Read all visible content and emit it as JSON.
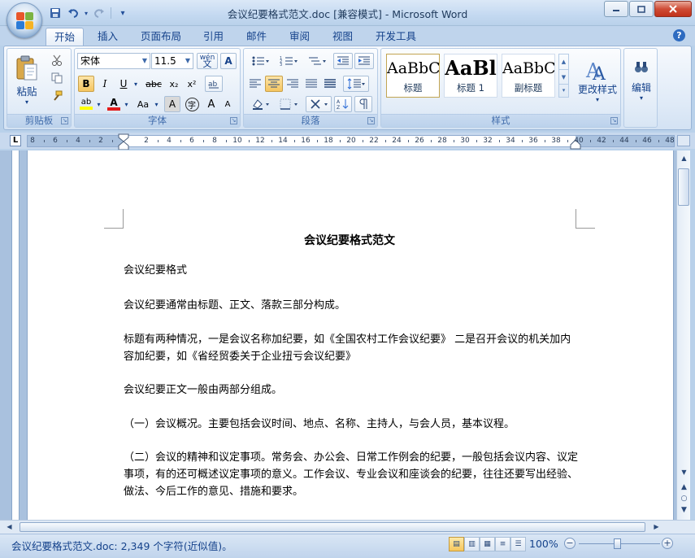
{
  "window": {
    "title": "会议纪要格式范文.doc [兼容模式] - Microsoft Word",
    "minimize": "—",
    "maximize": "□",
    "close": "✕"
  },
  "qat": {
    "save_icon": "save-icon",
    "undo_icon": "undo-icon",
    "redo_icon": "redo-icon",
    "customize": "▾"
  },
  "tabs": [
    {
      "label": "开始",
      "active": true
    },
    {
      "label": "插入"
    },
    {
      "label": "页面布局"
    },
    {
      "label": "引用"
    },
    {
      "label": "邮件"
    },
    {
      "label": "审阅"
    },
    {
      "label": "视图"
    },
    {
      "label": "开发工具"
    }
  ],
  "help": "?",
  "ribbon": {
    "clipboard": {
      "label": "剪贴板",
      "paste": "粘贴",
      "paste_arrow": "▾"
    },
    "font": {
      "label": "字体",
      "font_name": "宋体",
      "font_size": "11.5",
      "bold": "B",
      "italic": "I",
      "underline": "U",
      "strike": "abc",
      "subscript": "x₂",
      "superscript": "x²",
      "grow": "A",
      "shrink": "A",
      "change_case": "Aa",
      "char_border": "A",
      "enclose": "字",
      "wen": "wén",
      "clear": "A",
      "highlight": "ab",
      "fontcolor": "A"
    },
    "paragraph": {
      "label": "段落"
    },
    "styles": {
      "label": "样式",
      "items": [
        {
          "sample": "AaBbC",
          "name": "标题"
        },
        {
          "sample": "AaBl",
          "name": "标题 1"
        },
        {
          "sample": "AaBbC",
          "name": "副标题"
        }
      ],
      "change_styles": "更改样式"
    },
    "editing": {
      "label": "编辑"
    }
  },
  "ruler": {
    "corner": "L",
    "numbers": [
      "8",
      "6",
      "4",
      "2",
      "2",
      "4",
      "6",
      "8",
      "10",
      "12",
      "14",
      "16",
      "18",
      "20",
      "22",
      "24",
      "26",
      "28",
      "30",
      "32",
      "34",
      "36",
      "38",
      "40",
      "42",
      "44",
      "46",
      "48"
    ]
  },
  "document": {
    "title": "会议纪要格式范文",
    "paragraphs": [
      "会议纪要格式",
      "会议纪要通常由标题、正文、落款三部分构成。",
      "标题有两种情况，一是会议名称加纪要，如《全国农村工作会议纪要》 二是召开会议的机关加内容加纪要，如《省经贸委关于企业扭亏会议纪要》",
      "会议纪要正文一般由两部分组成。",
      "（一）会议概况。主要包括会议时间、地点、名称、主持人，与会人员，基本议程。",
      "（二）会议的精神和议定事项。常务会、办公会、日常工作例会的纪要，一般包括会议内容、议定事项，有的还可概述议定事项的意义。工作会议、专业会议和座谈会的纪要，往往还要写出经验、做法、今后工作的意见、措施和要求。"
    ]
  },
  "statusbar": {
    "text": "会议纪要格式范文.doc: 2,349 个字符(近似值)。",
    "zoom": "100%",
    "zoom_level_percent": 100,
    "zoom_minus": "−",
    "zoom_plus": "+"
  },
  "colors": {
    "accent": "#15428b",
    "ribbon_bg": "#dfeaf7",
    "selected_style_border": "#c2a552"
  }
}
